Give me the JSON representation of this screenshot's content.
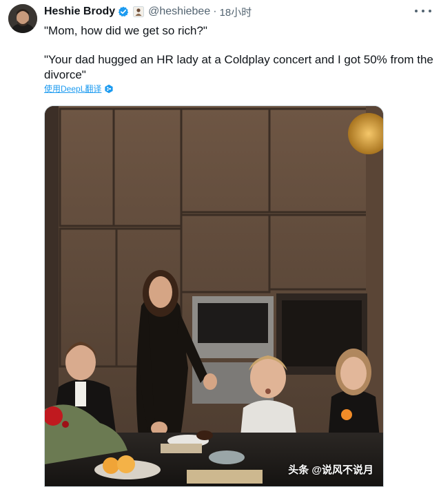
{
  "author": {
    "display_name": "Heshie Brody",
    "handle": "@heshiebee",
    "separator": "·",
    "time": "18小时"
  },
  "tweet": {
    "line1": "\"Mom, how did we get so rich?\"",
    "line2": "\"Your dad hugged an HR lady at a Coldplay concert and I got 50% from the divorce\""
  },
  "translate_link": "使用DeepL翻译",
  "watermark": "头条 @说风不说月",
  "icons": {
    "verified": "verified-badge-icon",
    "affiliate": "affiliate-badge-icon",
    "more": "more-options-icon",
    "deepl": "deepl-icon"
  },
  "colors": {
    "accent": "#1d9bf0",
    "secondary_text": "#536471",
    "primary_text": "#0f1419"
  }
}
